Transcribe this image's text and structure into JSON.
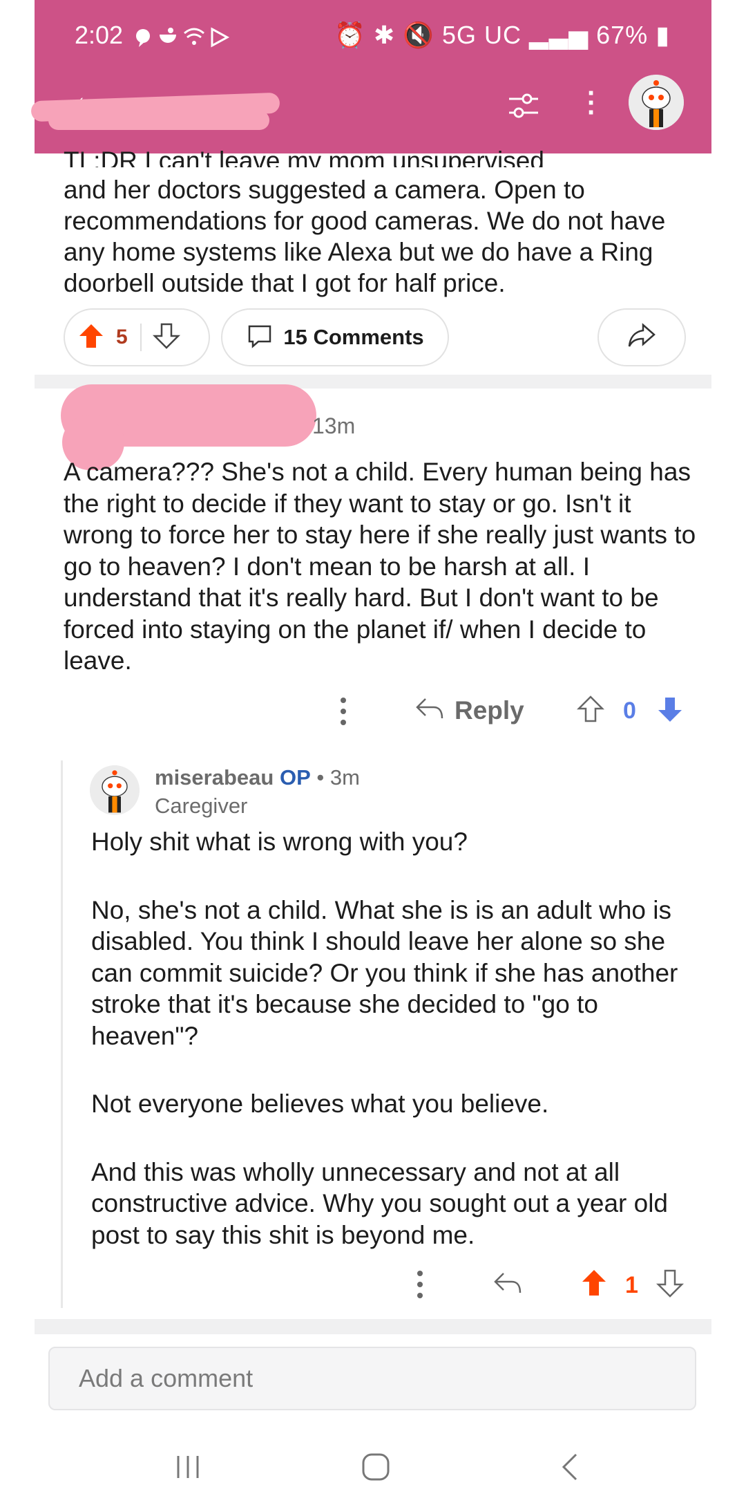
{
  "status_bar": {
    "time": "2:02",
    "right_text": "5G UC",
    "battery": "67%"
  },
  "header": {
    "back_icon": "back-arrow-icon",
    "filter_icon": "filter-icon",
    "more_icon": "more-vertical-icon"
  },
  "post": {
    "text_clipped": "TL;DR I can't leave my mom unsupervised",
    "text": "and her doctors suggested a camera. Open to recommendations for good cameras. We do not have any home systems like Alexa but we do have a Ring doorbell outside that I got for half price.",
    "score": "5",
    "comments_label": "15 Comments"
  },
  "comment1": {
    "time": "13m",
    "text": "A camera??? She's not a child. Every human being has the right to decide if they want to stay or go. Isn't it wrong to force her to stay here if she really just wants to go to heaven? I don't mean to be harsh at all. I understand that it's really hard. But I don't want to be forced into staying on the planet if/ when I decide to leave.",
    "reply_label": "Reply",
    "score": "0"
  },
  "comment2": {
    "username": "miserabeau",
    "op_badge": "OP",
    "meta": "• 3m",
    "flair": "Caregiver",
    "paragraphs": [
      "Holy shit what is wrong with you?",
      "No, she's not a child. What she is is an adult who is disabled. You think I should leave her alone so she can commit suicide? Or you think if she has another stroke that it's because she decided to \"go to heaven\"?",
      "Not everyone believes what you believe.",
      "And this was wholly unnecessary and not at all constructive advice. Why you sought out a year old post to say this shit is beyond me."
    ],
    "score": "1"
  },
  "composer": {
    "placeholder": "Add a comment"
  },
  "colors": {
    "header": "#cd5287",
    "upvote": "#ff4500",
    "downvote": "#5a7ee6",
    "op": "#2a5db0"
  }
}
